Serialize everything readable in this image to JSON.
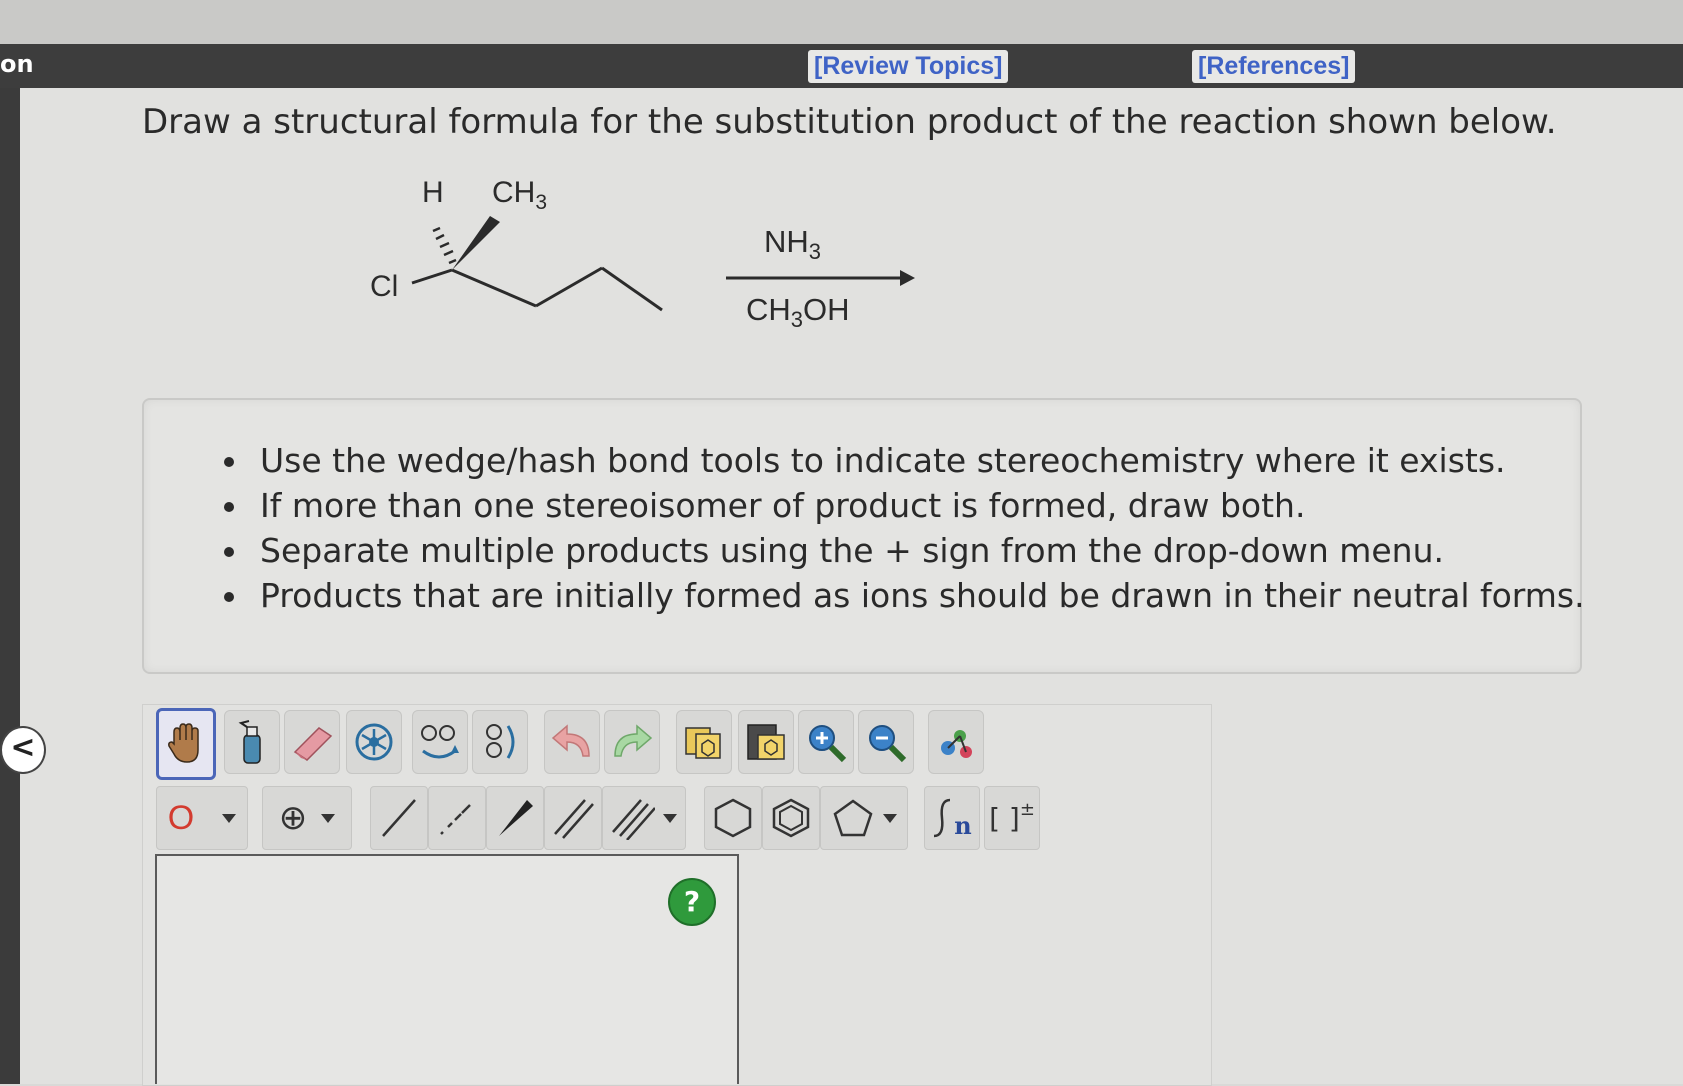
{
  "header": {
    "left_fragment": "on",
    "review_topics": "[Review Topics]",
    "references": "[References]"
  },
  "question": {
    "prompt": "Draw a structural formula for the substitution product of the reaction shown below."
  },
  "reaction": {
    "label_h": "H",
    "label_ch3": "CH",
    "label_ch3_sub": "3",
    "label_cl": "Cl",
    "reagent_top": "NH",
    "reagent_top_sub": "3",
    "reagent_bottom": "CH",
    "reagent_bottom_sub": "3",
    "reagent_bottom_tail": "OH"
  },
  "instructions": [
    "Use the wedge/hash bond tools to indicate stereochemistry where it exists.",
    "If more than one stereoisomer of product is formed, draw both.",
    "Separate multiple products using the + sign from the drop-down menu.",
    "Products that are initially formed as ions should be drawn in their neutral forms."
  ],
  "toolbar": {
    "atom_selected": "O",
    "charge_symbol": "⊕",
    "sgroup_label": "n",
    "bracket_label": "[ ]",
    "bracket_sup": "±"
  },
  "editor": {
    "help_label": "?",
    "collapse_label": "<"
  }
}
